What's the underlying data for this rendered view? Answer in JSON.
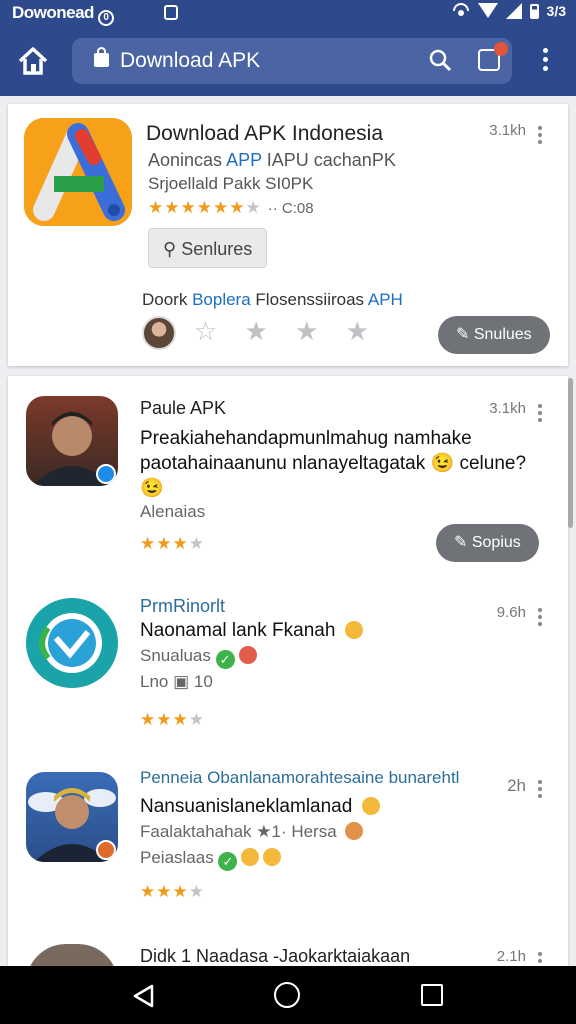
{
  "status_bar": {
    "left_text": "Dowonead",
    "download_glyph": "0",
    "time": "3/3"
  },
  "toolbar": {
    "search_text": "Download APK"
  },
  "featured": {
    "title": "Download APK Indonesia",
    "subtitle_pre": "Aonincas ",
    "subtitle_hl": "APP",
    "subtitle_post": " IAPU cachanPK",
    "meta": "Srjoellald Pakk SI0PK",
    "stars": "★★★★★★",
    "stars_dim": "★",
    "rating_meta": "·· C:08",
    "time": "3.1kh",
    "chip_label": "Senlures",
    "chip_icon": "person-icon",
    "source_pre": "Doork ",
    "source_hl1": "Boplera",
    "source_mid": "  Flosenssiiroas ",
    "source_hl2": "APH",
    "rate_glyphs": "☆ ★ ★ ★",
    "action_label": "Snulues"
  },
  "items": [
    {
      "name": "Paule APK",
      "time": "3.1kh",
      "text": "Preakiahehandapmunlmahug namhake paotahainaanunu nlanayeltagatak 😉 celune? 😉",
      "sub": "Alenaias",
      "stars": "★★★",
      "stars_dim": "★",
      "action_label": "Sopius"
    },
    {
      "name": "PrmRinorlt",
      "time": "9.6h",
      "text": "Naonamal lank Fkanah",
      "sub1": "Snualuas",
      "sub2": "Lno",
      "sub2_count": "10",
      "stars": "★★★",
      "stars_dim": "★"
    },
    {
      "name": "Penneia Obanlanamorahtesaine bunarehtl",
      "time": "2h",
      "text": "Nansuanislaneklamlanad",
      "sub1": "Faalaktahahak ★1· Hersa",
      "sub2": "Peiaslaas",
      "stars": "★★★",
      "stars_dim": "★"
    },
    {
      "name": "Didk 1 Naadasa -Jaokarktaiakaan",
      "time": "2.1h"
    }
  ],
  "colors": {
    "app_bar": "#2f4a8c",
    "accent": "#1b6ec2",
    "star": "#f19b1c"
  }
}
